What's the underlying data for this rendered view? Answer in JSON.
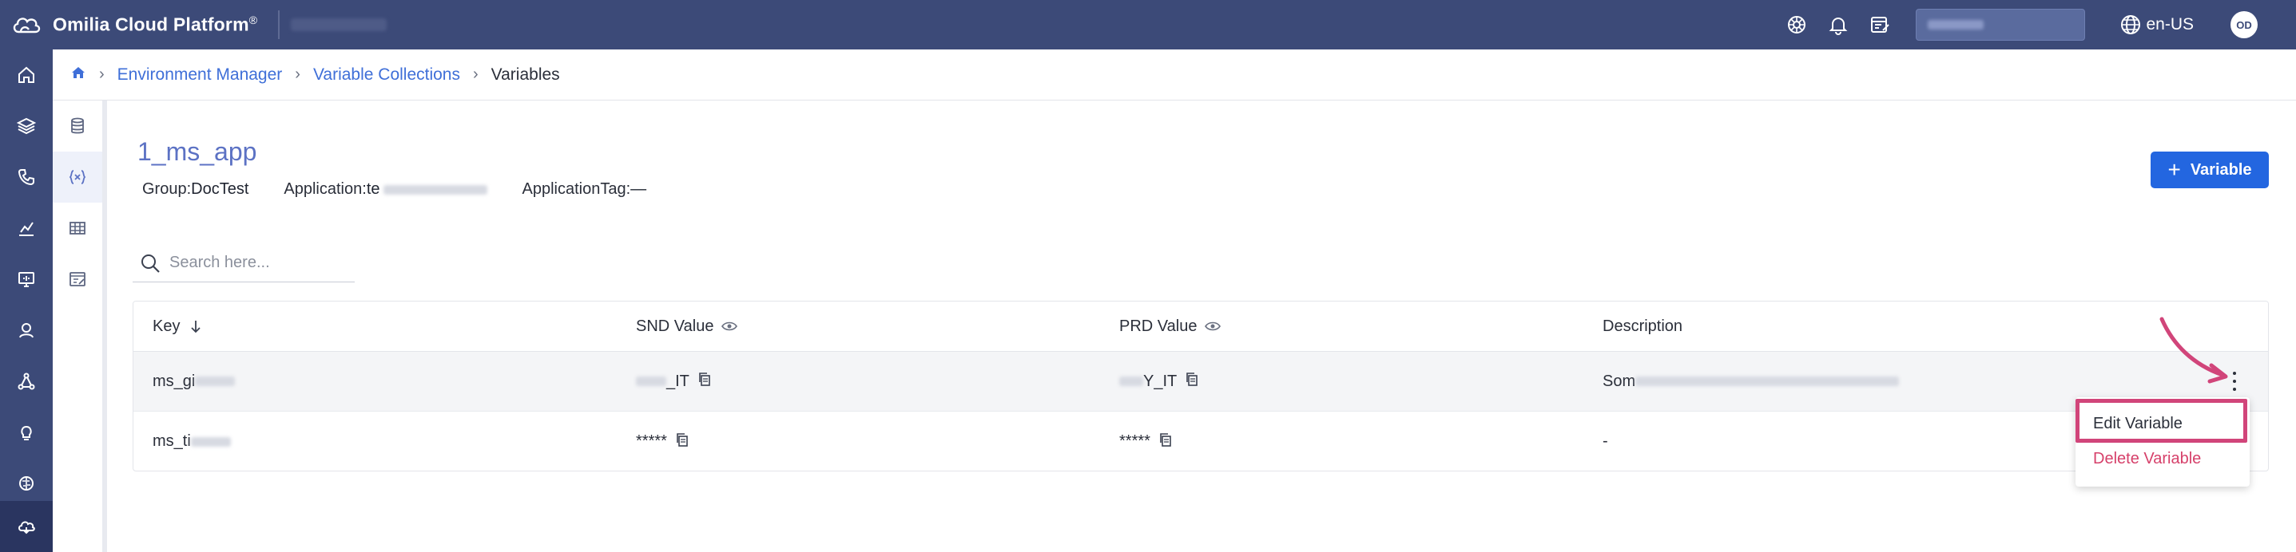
{
  "topbar": {
    "brand_name": "Omilia Cloud Platform",
    "brand_mark": "®",
    "language": "en-US",
    "avatar_initials": "OD",
    "icons": [
      "sun-icon",
      "bell-icon",
      "notes-icon",
      "globe-icon"
    ]
  },
  "rail": {
    "icons": [
      "home-icon",
      "layers-icon",
      "phone-icon",
      "analytics-icon",
      "monitor-icon",
      "agent-icon",
      "network-icon",
      "lightbulb-icon",
      "brain-icon",
      "cloud-icon"
    ]
  },
  "subnav": {
    "icons": [
      "database-icon",
      "variables-icon",
      "table-icon",
      "form-icon"
    ]
  },
  "breadcrumb": {
    "items": [
      "Environment Manager",
      "Variable Collections"
    ],
    "current": "Variables"
  },
  "page": {
    "title": "1_ms_app",
    "group_label": "Group: ",
    "group_value": "DocTest",
    "application_label": "Application: ",
    "application_value_prefix": "te",
    "application_tag_label": "ApplicationTag: ",
    "application_tag_value": "—",
    "add_button_label": "Variable"
  },
  "search": {
    "placeholder": "Search here..."
  },
  "table": {
    "columns": [
      "Key",
      "SND Value",
      "PRD Value",
      "Description"
    ],
    "rows": [
      {
        "key": "ms_gi",
        "snd": "_IT",
        "prd": "Y_IT",
        "description": "Som"
      },
      {
        "key": "ms_ti",
        "snd": "*****",
        "prd": "*****",
        "description": "-"
      }
    ]
  },
  "menu": {
    "edit_label": "Edit Variable",
    "delete_label": "Delete Variable"
  },
  "colors": {
    "topbar": "#3c4a78",
    "primary": "#2366e0",
    "title": "#5c72c4",
    "link": "#3f6fd8",
    "danger": "#d6406a",
    "highlight": "#d1457a"
  }
}
